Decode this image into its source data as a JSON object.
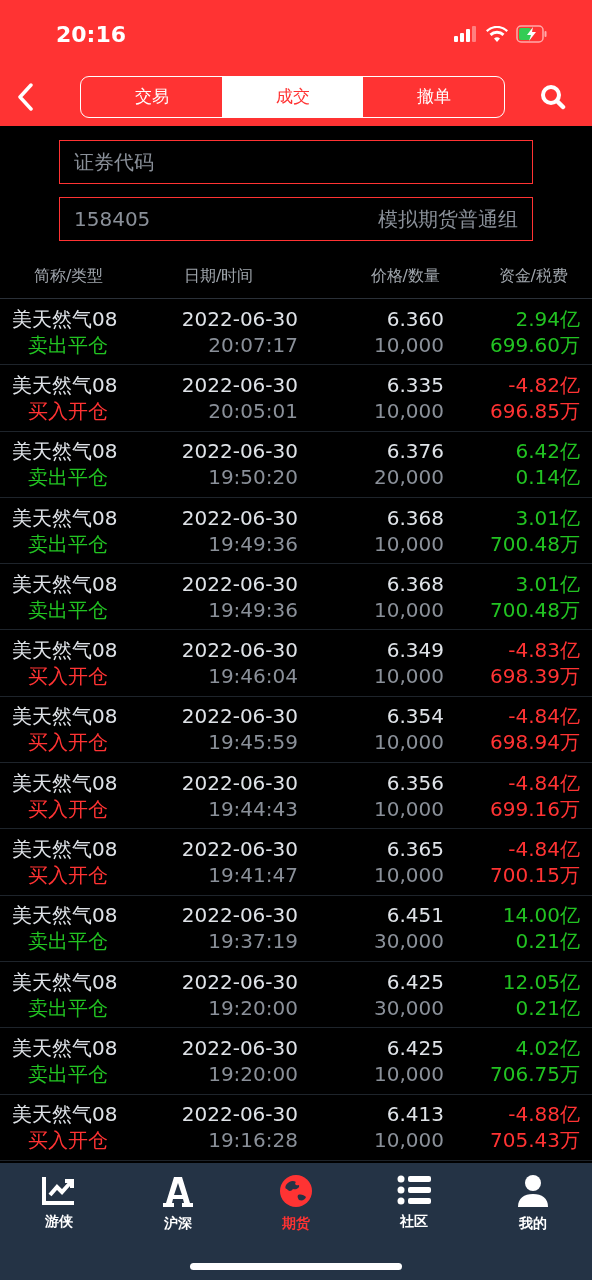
{
  "status_bar": {
    "time": "20:16"
  },
  "tabs": [
    {
      "label": "交易",
      "selected": false
    },
    {
      "label": "成交",
      "selected": true
    },
    {
      "label": "撤单",
      "selected": false
    }
  ],
  "code_field": {
    "placeholder": "证券代码"
  },
  "account": {
    "number": "158405",
    "group": "模拟期货普通组"
  },
  "columns": [
    "简称/类型",
    "日期/时间",
    "价格/数量",
    "资金/税费"
  ],
  "rows": [
    {
      "name": "美天然气08",
      "kind": "sell",
      "type": "卖出平仓",
      "date": "2022-06-30",
      "time": "20:07:17",
      "price": "6.360",
      "quantity": "10,000",
      "amount": "2.94亿",
      "fee": "699.60万"
    },
    {
      "name": "美天然气08",
      "kind": "buy",
      "type": "买入开仓",
      "date": "2022-06-30",
      "time": "20:05:01",
      "price": "6.335",
      "quantity": "10,000",
      "amount": "-4.82亿",
      "fee": "696.85万"
    },
    {
      "name": "美天然气08",
      "kind": "sell",
      "type": "卖出平仓",
      "date": "2022-06-30",
      "time": "19:50:20",
      "price": "6.376",
      "quantity": "20,000",
      "amount": "6.42亿",
      "fee": "0.14亿"
    },
    {
      "name": "美天然气08",
      "kind": "sell",
      "type": "卖出平仓",
      "date": "2022-06-30",
      "time": "19:49:36",
      "price": "6.368",
      "quantity": "10,000",
      "amount": "3.01亿",
      "fee": "700.48万"
    },
    {
      "name": "美天然气08",
      "kind": "sell",
      "type": "卖出平仓",
      "date": "2022-06-30",
      "time": "19:49:36",
      "price": "6.368",
      "quantity": "10,000",
      "amount": "3.01亿",
      "fee": "700.48万"
    },
    {
      "name": "美天然气08",
      "kind": "buy",
      "type": "买入开仓",
      "date": "2022-06-30",
      "time": "19:46:04",
      "price": "6.349",
      "quantity": "10,000",
      "amount": "-4.83亿",
      "fee": "698.39万"
    },
    {
      "name": "美天然气08",
      "kind": "buy",
      "type": "买入开仓",
      "date": "2022-06-30",
      "time": "19:45:59",
      "price": "6.354",
      "quantity": "10,000",
      "amount": "-4.84亿",
      "fee": "698.94万"
    },
    {
      "name": "美天然气08",
      "kind": "buy",
      "type": "买入开仓",
      "date": "2022-06-30",
      "time": "19:44:43",
      "price": "6.356",
      "quantity": "10,000",
      "amount": "-4.84亿",
      "fee": "699.16万"
    },
    {
      "name": "美天然气08",
      "kind": "buy",
      "type": "买入开仓",
      "date": "2022-06-30",
      "time": "19:41:47",
      "price": "6.365",
      "quantity": "10,000",
      "amount": "-4.84亿",
      "fee": "700.15万"
    },
    {
      "name": "美天然气08",
      "kind": "sell",
      "type": "卖出平仓",
      "date": "2022-06-30",
      "time": "19:37:19",
      "price": "6.451",
      "quantity": "30,000",
      "amount": "14.00亿",
      "fee": "0.21亿"
    },
    {
      "name": "美天然气08",
      "kind": "sell",
      "type": "卖出平仓",
      "date": "2022-06-30",
      "time": "19:20:00",
      "price": "6.425",
      "quantity": "30,000",
      "amount": "12.05亿",
      "fee": "0.21亿"
    },
    {
      "name": "美天然气08",
      "kind": "sell",
      "type": "卖出平仓",
      "date": "2022-06-30",
      "time": "19:20:00",
      "price": "6.425",
      "quantity": "10,000",
      "amount": "4.02亿",
      "fee": "706.75万"
    },
    {
      "name": "美天然气08",
      "kind": "buy",
      "type": "买入开仓",
      "date": "2022-06-30",
      "time": "19:16:28",
      "price": "6.413",
      "quantity": "10,000",
      "amount": "-4.88亿",
      "fee": "705.43万"
    }
  ],
  "nav": [
    {
      "label": "游侠",
      "kind": "chart",
      "selected": false
    },
    {
      "label": "沪深",
      "kind": "letter",
      "selected": false
    },
    {
      "label": "期货",
      "kind": "globe",
      "selected": true
    },
    {
      "label": "社区",
      "kind": "list",
      "selected": false
    },
    {
      "label": "我的",
      "kind": "user",
      "selected": false
    }
  ]
}
